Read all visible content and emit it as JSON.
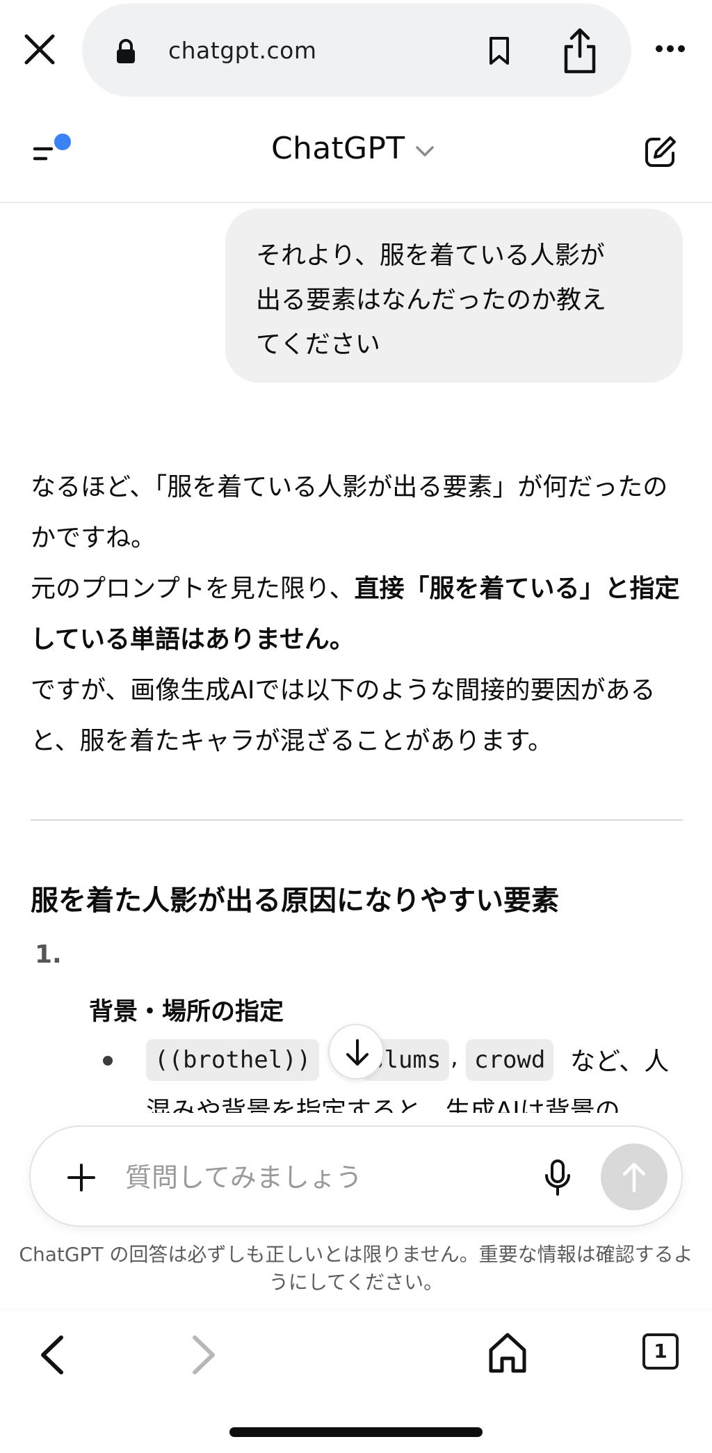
{
  "browser": {
    "url": "chatgpt.com"
  },
  "header": {
    "title": "ChatGPT"
  },
  "conversation": {
    "user_message": "それより、服を着ている人影が\n出る要素はなんだったのか教え\nてください",
    "assistant": {
      "para1": "なるほど、「服を着ている人影が出る要素」が何だったのかですね。",
      "para2_prefix": "元のプロンプトを見た限り、",
      "para2_bold": "直接「服を着ている」と指定している単語はありません。",
      "para3": "ですが、画像生成AIでは以下のような間接的要因があると、服を着たキャラが混ざることがあります。",
      "section_heading": "服を着た人影が出る原因になりやすい要素",
      "list_number": "1.",
      "list_item_title": "背景・場所の指定",
      "code_terms": [
        "((brothel))",
        "slums",
        "crowd"
      ],
      "comma": ",",
      "bullet_tail": " など、人",
      "bullet_line2": "混みや背景を指定すると、生成AIは背景の"
    }
  },
  "composer": {
    "placeholder": "質問してみましょう"
  },
  "disclaimer": "ChatGPT の回答は必ずしも正しいとは限りません。重要な情報は確認するようにしてください。",
  "bottom_bar": {
    "tab_count": "1"
  },
  "colors": {
    "accent_dot": "#3b82f6",
    "bubble_bg": "#f0f0f0",
    "send_disabled": "#d9d9d9"
  }
}
